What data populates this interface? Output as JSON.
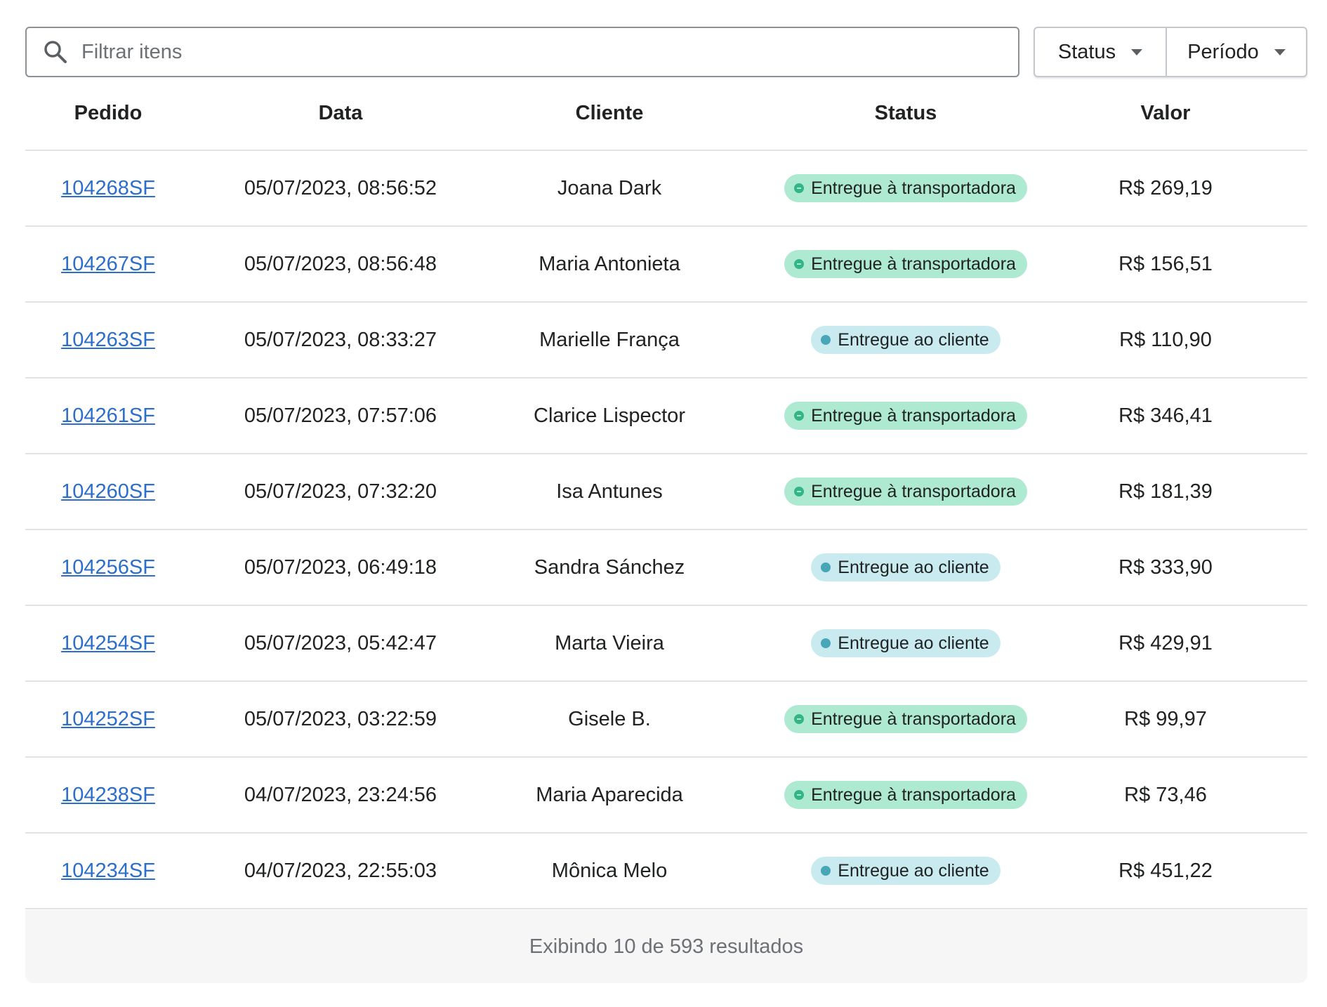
{
  "search": {
    "placeholder": "Filtrar itens",
    "value": ""
  },
  "filters": {
    "status_label": "Status",
    "periodo_label": "Período"
  },
  "table": {
    "columns": [
      "Pedido",
      "Data",
      "Cliente",
      "Status",
      "Valor"
    ],
    "rows": [
      {
        "order": "104268SF",
        "date": "05/07/2023, 08:56:52",
        "customer": "Joana Dark",
        "status": "Entregue à transportadora",
        "value": "R$ 269,19"
      },
      {
        "order": "104267SF",
        "date": "05/07/2023, 08:56:48",
        "customer": "Maria Antonieta",
        "status": "Entregue à transportadora",
        "value": "R$ 156,51"
      },
      {
        "order": "104263SF",
        "date": "05/07/2023, 08:33:27",
        "customer": "Marielle França",
        "status": "Entregue ao cliente",
        "value": "R$ 110,90"
      },
      {
        "order": "104261SF",
        "date": "05/07/2023, 07:57:06",
        "customer": "Clarice Lispector",
        "status": "Entregue à transportadora",
        "value": "R$ 346,41"
      },
      {
        "order": "104260SF",
        "date": "05/07/2023, 07:32:20",
        "customer": "Isa Antunes",
        "status": "Entregue à transportadora",
        "value": "R$ 181,39"
      },
      {
        "order": "104256SF",
        "date": "05/07/2023, 06:49:18",
        "customer": "Sandra Sánchez",
        "status": "Entregue ao cliente",
        "value": "R$ 333,90"
      },
      {
        "order": "104254SF",
        "date": "05/07/2023, 05:42:47",
        "customer": "Marta Vieira",
        "status": "Entregue ao cliente",
        "value": "R$ 429,91"
      },
      {
        "order": "104252SF",
        "date": "05/07/2023, 03:22:59",
        "customer": "Gisele B.",
        "status": "Entregue à transportadora",
        "value": "R$ 99,97"
      },
      {
        "order": "104238SF",
        "date": "04/07/2023, 23:24:56",
        "customer": "Maria Aparecida",
        "status": "Entregue à transportadora",
        "value": "R$ 73,46"
      },
      {
        "order": "104234SF",
        "date": "04/07/2023, 22:55:03",
        "customer": "Mônica Melo",
        "status": "Entregue ao cliente",
        "value": "R$ 451,22"
      }
    ]
  },
  "footer": {
    "text": "Exibindo 10 de 593 resultados"
  },
  "colors": {
    "link": "#2c6ecb",
    "badge_carrier_bg": "#aee9d1",
    "badge_carrier_dot": "#33b58a",
    "badge_customer_bg": "#c9ebf0",
    "badge_customer_dot": "#49a6b9"
  },
  "icons": {
    "search": "search-icon",
    "dropdown": "caret-down-icon"
  }
}
